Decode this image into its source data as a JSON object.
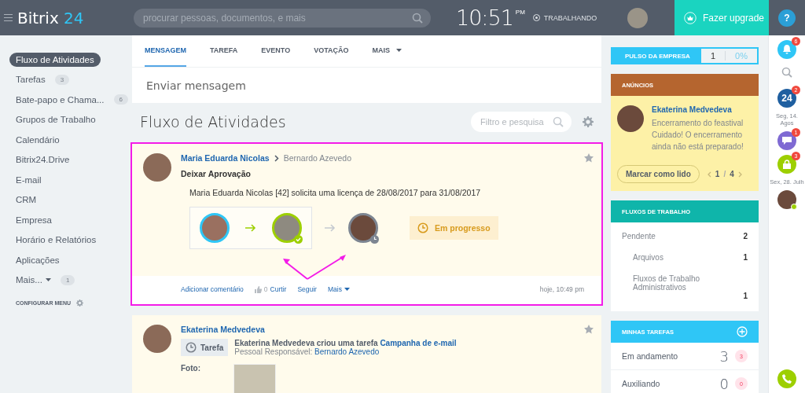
{
  "header": {
    "logo": {
      "text": "Bitrix",
      "accent": "24"
    },
    "search": {
      "placeholder": "procurar pessoas, documentos, e mais"
    },
    "clock": {
      "time": "10:51",
      "period": "PM"
    },
    "status": "TRABALHANDO",
    "upgrade": "Fazer upgrade",
    "help": "?"
  },
  "sidebar": {
    "items": [
      {
        "label": "Fluxo de Atividades",
        "selected": true
      },
      {
        "label": "Tarefas",
        "count": "3",
        "selected": false
      },
      {
        "label": "Bate-papo e Chama...",
        "count": "6",
        "selected": false
      },
      {
        "label": "Grupos de Trabalho",
        "selected": false
      },
      {
        "label": "Calendário",
        "selected": false
      },
      {
        "label": "Bitrix24.Drive",
        "selected": false
      },
      {
        "label": "E-mail",
        "selected": false
      },
      {
        "label": "CRM",
        "selected": false
      },
      {
        "label": "Empresa",
        "selected": false
      },
      {
        "label": "Horário e Relatórios",
        "selected": false
      },
      {
        "label": "Aplicações",
        "selected": false
      },
      {
        "label": "Mais...",
        "count": "1",
        "has_menu": true,
        "selected": false
      }
    ],
    "configure": "CONFIGURAR MENU"
  },
  "composer": {
    "tabs": [
      {
        "label": "MENSAGEM",
        "selected": true,
        "has_menu": false
      },
      {
        "label": "TAREFA",
        "selected": false,
        "has_menu": false
      },
      {
        "label": "EVENTO",
        "selected": false,
        "has_menu": false
      },
      {
        "label": "VOTAÇÃO",
        "selected": false,
        "has_menu": false
      },
      {
        "label": "MAIS",
        "selected": false,
        "has_menu": true
      }
    ],
    "placeholder": "Enviar mensagem"
  },
  "feed": {
    "title": "Fluxo de Atividades",
    "filter": {
      "placeholder": "Filtro e pesquisa"
    },
    "posts": [
      {
        "kind": "approval",
        "highlighted": true,
        "author": "Maria Eduarda Nicolas",
        "recipient": "Bernardo Azevedo",
        "title": "Deixar Aprovação",
        "text": "Maria Eduarda Nicolas [42] solicita uma licença de 28/08/2017 para 31/08/2017",
        "steps": [
          {
            "kind": "start"
          },
          {
            "kind": "approved"
          },
          {
            "kind": "pending"
          }
        ],
        "state_label": "Em progresso",
        "actions": [
          {
            "kind": "link",
            "label": "Adicionar comentário"
          },
          {
            "kind": "like",
            "count": "0",
            "label": "Curtir"
          },
          {
            "kind": "link",
            "label": "Seguir"
          },
          {
            "kind": "menu",
            "label": "Mais"
          }
        ],
        "time": "hoje, 10:49 pm"
      },
      {
        "kind": "task",
        "highlighted": false,
        "author": "Ekaterina Medvedeva",
        "tag": "Tarefa",
        "text": "Ekaterina Medvedeva criou uma tarefa",
        "link": "Campanha de e-mail",
        "responsible_label": "Pessoal Responsável:",
        "responsible": "Bernardo Azevedo",
        "photo_label": "Foto:"
      }
    ]
  },
  "right": {
    "pulse": {
      "label": "PULSO DA EMPRESA",
      "count": "1",
      "percent": "0%"
    },
    "announcements": {
      "title": "ANÚNCIOS",
      "author": "Ekaterina Medvedeva",
      "text": "Encerramento do feastival Cuidado! O encerramento ainda não está preparado!",
      "button": "Marcar como lido",
      "page": "1",
      "separator": "/",
      "total": "4"
    },
    "workflows": {
      "title": "FLUXOS DE TRABALHO",
      "rows": [
        {
          "label": "Pendente",
          "count": "2",
          "children": [
            {
              "label": "Arquivos",
              "count": "1"
            },
            {
              "label": "Fluxos de Trabalho Administrativos",
              "count": "1"
            }
          ]
        }
      ]
    },
    "tasks": {
      "title": "MINHAS TAREFAS",
      "rows": [
        {
          "label": "Em andamento",
          "count": "3",
          "badge": "3"
        },
        {
          "label": "Auxiliando",
          "count": "0",
          "badge": "0"
        }
      ]
    }
  },
  "strip": {
    "items": [
      {
        "kind": "bell",
        "badge": "6"
      },
      {
        "kind": "search"
      },
      {
        "kind": "logo",
        "text": "24",
        "badge": "2"
      },
      {
        "kind": "date",
        "text": "Seg, 14. Agos"
      },
      {
        "kind": "chat",
        "badge": "1"
      },
      {
        "kind": "lock",
        "badge": "3"
      },
      {
        "kind": "date",
        "text": "Sex, 28. Julh"
      },
      {
        "kind": "avatar",
        "online": true
      },
      {
        "kind": "phone"
      }
    ]
  }
}
